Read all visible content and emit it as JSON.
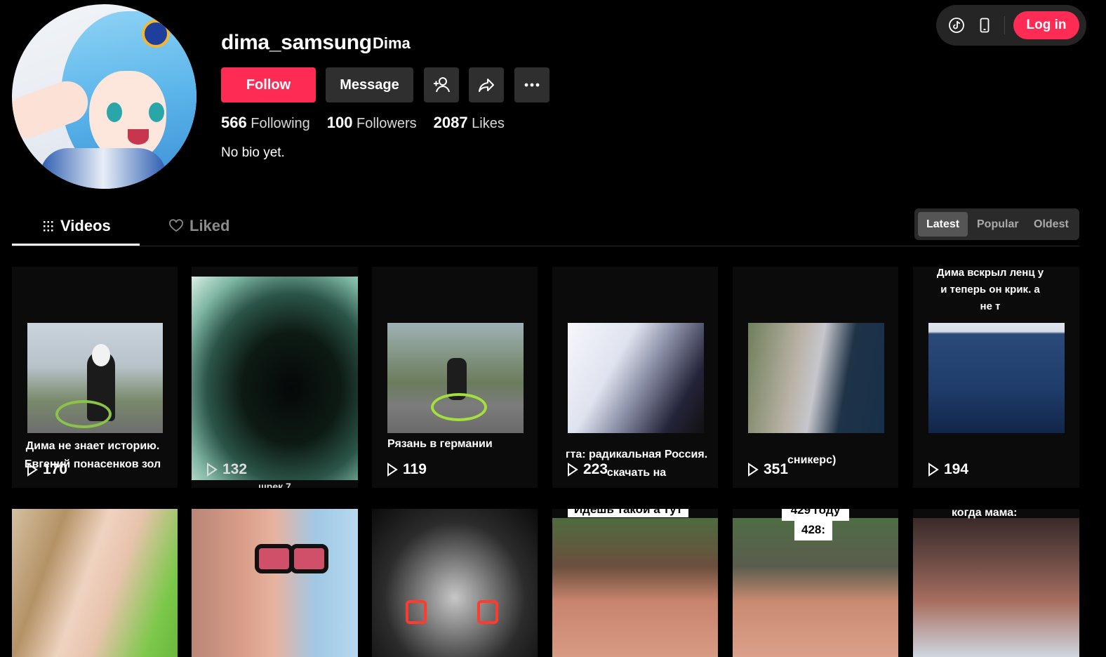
{
  "profile": {
    "username": "dima_samsung",
    "nickname": "Dima",
    "bio": "No bio yet.",
    "stats": [
      {
        "value": "566",
        "label": "Following"
      },
      {
        "value": "100",
        "label": "Followers"
      },
      {
        "value": "2087",
        "label": "Likes"
      }
    ]
  },
  "actions": {
    "follow": "Follow",
    "message": "Message"
  },
  "topbar": {
    "login": "Log in"
  },
  "tabs": {
    "videos": "Videos",
    "liked": "Liked"
  },
  "sort": {
    "latest": "Latest",
    "popular": "Popular",
    "oldest": "Oldest"
  },
  "videos": [
    {
      "views": "170",
      "caption": "Дима не знает историю. Евгений понасенков зол"
    },
    {
      "views": "132",
      "caption": "шрек 7"
    },
    {
      "views": "119",
      "caption": "Рязань в германии"
    },
    {
      "views": "223",
      "caption": "гта: радикальная Россия. скачать на"
    },
    {
      "views": "351",
      "caption": "сникерс)"
    },
    {
      "views": "194",
      "caption": "Дима вскрыл ленц у и теперь он крик. а не т"
    }
  ],
  "row2_labels": {
    "v4": "Идешь такой а тут",
    "v5_top": "429 году",
    "v5_bottom": "428:",
    "v6": "когда мама:"
  },
  "colors": {
    "accent": "#fe2c55",
    "button_bg": "#2f2f2f",
    "background": "#000000"
  }
}
